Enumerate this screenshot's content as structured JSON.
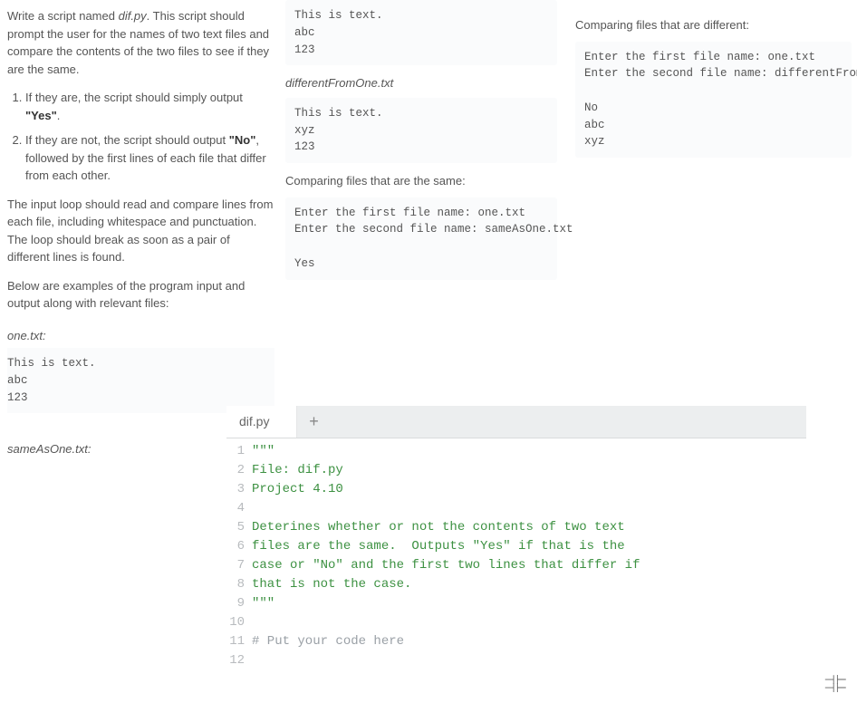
{
  "instructions": {
    "intro_a": "Write a script named ",
    "intro_script": "dif.py",
    "intro_b": ". This script should prompt the user for the names of two text files and compare the contents of the two files to see if they are the same.",
    "li1_a": "If they are, the script should simply output ",
    "li1_b": "\"Yes\"",
    "li1_c": ".",
    "li2_a": "If they are not, the script should output ",
    "li2_b": "\"No\"",
    "li2_c": ", followed by the first lines of each file that differ from each other.",
    "para2": "The input loop should read and compare lines from each file, including whitespace and punctuation. The loop should break as soon as a pair of different lines is found.",
    "para3": "Below are examples of the program input and output along with relevant files:",
    "file1_label": "one.txt:",
    "file1_content": "This is text.\nabc\n123",
    "file2_label": "sameAsOne.txt:"
  },
  "midcol": {
    "top_block": "This is text.\nabc\n123",
    "diff_label": "differentFromOne.txt",
    "diff_block": "This is text.\nxyz\n123",
    "same_heading": "Comparing files that are the same:",
    "same_output": "Enter the first file name: one.txt\nEnter the second file name: sameAsOne.txt\n\nYes"
  },
  "rightcol": {
    "diff_heading": "Comparing files that are different:",
    "diff_output": "Enter the first file name: one.txt\nEnter the second file name: differentFromOne.txt\n\nNo\nabc\nxyz"
  },
  "editor": {
    "tab_label": "dif.py",
    "lines": [
      {
        "n": 1,
        "cls": "tok-string",
        "t": "\"\"\""
      },
      {
        "n": 2,
        "cls": "tok-string",
        "t": "File: dif.py"
      },
      {
        "n": 3,
        "cls": "tok-string",
        "t": "Project 4.10"
      },
      {
        "n": 4,
        "cls": "",
        "t": ""
      },
      {
        "n": 5,
        "cls": "tok-string",
        "t": "Deterines whether or not the contents of two text"
      },
      {
        "n": 6,
        "cls": "tok-string",
        "t": "files are the same.  Outputs \"Yes\" if that is the"
      },
      {
        "n": 7,
        "cls": "tok-string",
        "t": "case or \"No\" and the first two lines that differ if"
      },
      {
        "n": 8,
        "cls": "tok-string",
        "t": "that is not the case."
      },
      {
        "n": 9,
        "cls": "tok-string",
        "t": "\"\"\""
      },
      {
        "n": 10,
        "cls": "",
        "t": ""
      },
      {
        "n": 11,
        "cls": "tok-comment",
        "t": "# Put your code here"
      },
      {
        "n": 12,
        "cls": "",
        "t": ""
      }
    ]
  },
  "collapse_icon": "⊹"
}
